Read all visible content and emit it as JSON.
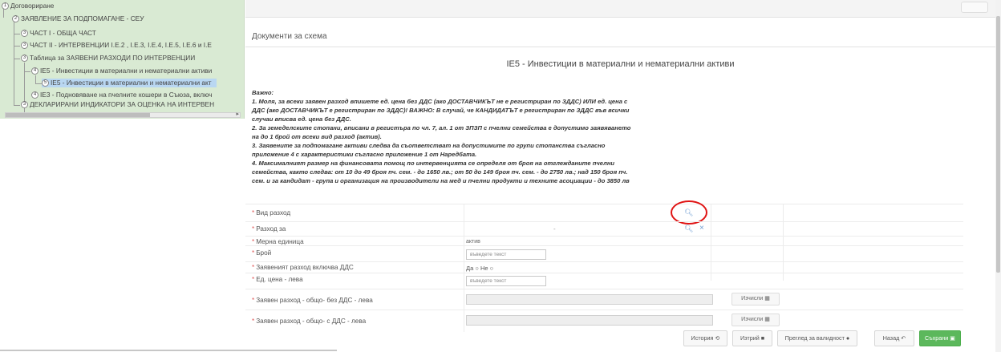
{
  "tree": {
    "nodes": [
      {
        "num": "1",
        "label": "Договориране"
      },
      {
        "num": "2",
        "label": "ЗАЯВЛЕНИЕ ЗА ПОДПОМАГАНЕ - СЕУ"
      },
      {
        "num": "3",
        "label": "ЧАСТ I - ОБЩА ЧАСТ"
      },
      {
        "num": "3",
        "label": "ЧАСТ II - ИНТЕРВЕНЦИИ I.Е.2 , I.Е.3, I.Е.4, I.Е.5, I.Е.6 и I.Е"
      },
      {
        "num": "3",
        "label": "Таблица за ЗАЯВЕНИ РАЗХОДИ ПО ИНТЕРВЕНЦИИ"
      },
      {
        "num": "4",
        "label": "IE5 - Инвестиции в материални и нематериални активи"
      },
      {
        "num": "5",
        "label": "IE5 - Инвестиции в материални и нематериални акт"
      },
      {
        "num": "4",
        "label": "IE3 - Подновяване на пчелните кошери в Съюза, включ"
      },
      {
        "num": "3",
        "label": "ДЕКЛАРИРАНИ ИНДИКАТОРИ ЗА ОЦЕНКА НА ИНТЕРВЕН"
      }
    ]
  },
  "main": {
    "section_title": "Документи за схема",
    "schema_title": "IE5 - Инвестиции в материални и нематериални активи",
    "notes": [
      "Важно:",
      "1. Моля, за всеки заявен разход впишете ед. цена без ДДС (ако ДОСТАВЧИКЪТ не е регистриран по ЗДДС) ИЛИ ед. цена с",
      "ДДС (ако ДОСТАВЧИКЪТ е регистриран по ЗДДС)! ВАЖНО: В случай, че КАНДИДАТЪТ е регистриран по ЗДДС във всички",
      "случаи вписва ед. цена без ДДС.",
      "2. За земеделските стопани, вписани в регистъра по чл. 7, ал. 1 от ЗПЗП с пчелни семейства е допустимо заявяването",
      "на до 1 брой от всеки вид разход (актив).",
      "3. Заявените за подпомагане активи следва да съответстват на допустимите по групи стопанства съгласно",
      "приложение 4 с характеристики съгласно приложение 1 от Наредбата.",
      "4. Максималният размер на финансовата помощ по интервенцията се определя от броя на отглежданите пчелни",
      "семейства, както следва: от 10 до 49 броя пч. сем. - до 1650 лв.; от 50 до 149 броя пч. сем. - до 2750 лв.; над 150 броя пч.",
      "сем. и за кандидат - група и организация на производители на мед и пчелни продукти и техните асоциации - до 3850 лв"
    ],
    "form": {
      "required_mark": "*",
      "expense_type_label": "Вид разход",
      "expense_for_label": "Разход за",
      "expense_for_dot": "-",
      "unit_label": "Мерна единица",
      "unit_value": "актив",
      "count_label": "Брой",
      "count_placeholder": "въведете текст",
      "vat_label": "Заявеният разход включва ДДС",
      "vat_yes": "Да",
      "vat_no": "Не",
      "unit_price_label": "Ед. цена - лева",
      "unit_price_placeholder": "въведете текст",
      "total_no_vat_label": "Заявен разход - общо- без ДДС - лева",
      "total_vat_label": "Заявен разход - общо- с ДДС - лева",
      "calc_label": "Изчисли"
    },
    "footer": {
      "history": "История",
      "delete": "Изтрий",
      "validity": "Преглед за валидност",
      "back": "Назад",
      "save": "Съхрани"
    }
  },
  "colors": {
    "tree_bg": "#d9ead3",
    "tree_selected": "#b9d7f2",
    "required": "#e05a5a",
    "save_button": "#5cb85c",
    "highlight_circle": "#e01414",
    "search_icon": "#6b9bd1"
  }
}
